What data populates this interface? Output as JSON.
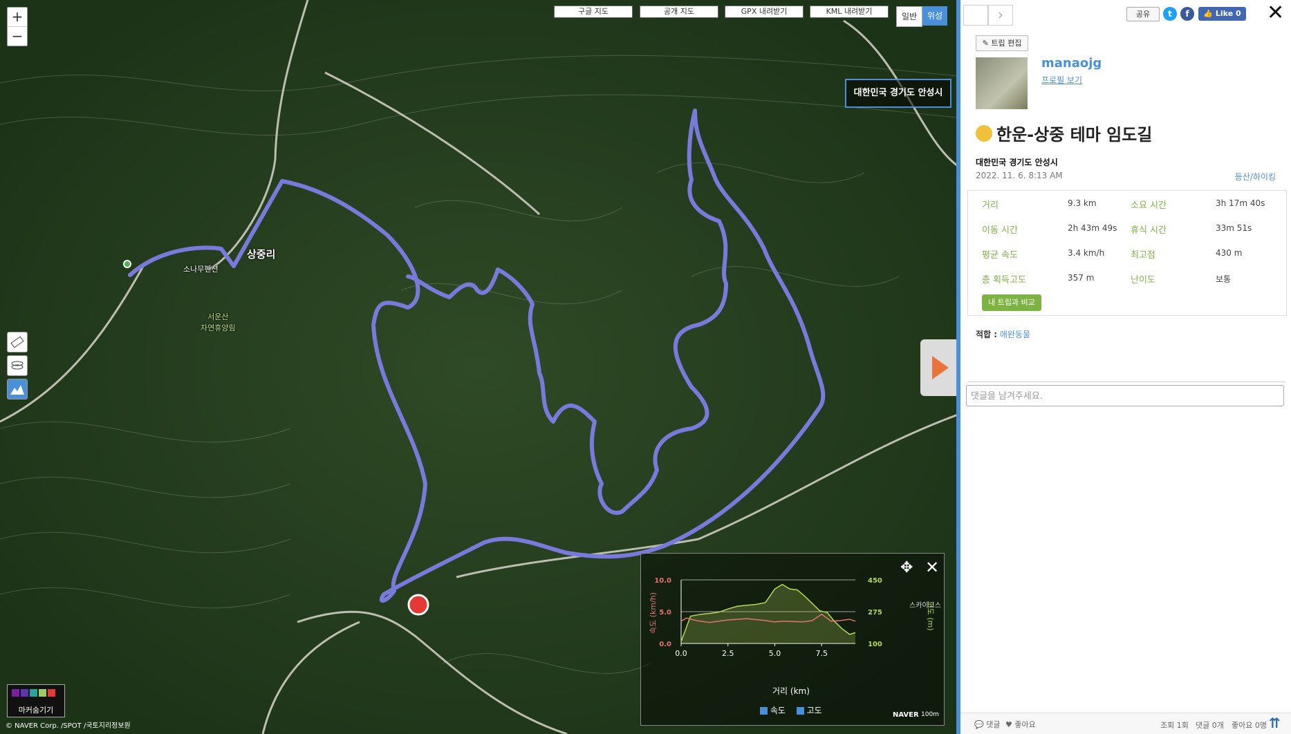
{
  "map": {
    "zoom_in": "+",
    "zoom_out": "−",
    "top_buttons": [
      "구글 지도",
      "공개 지도",
      "GPX 내려받기",
      "KML 내려받기"
    ],
    "map_types": [
      "일반",
      "위성"
    ],
    "location_label": "대한민국 경기도 안성시",
    "labels": [
      "상중리",
      "소나무펜션",
      "서운산\n자연휴양림",
      "스카이코스"
    ],
    "marker_tool": "마커숨기기",
    "copyright": "© NAVER Corp. /SPOT /국토지리정보원",
    "naver": "NAVER",
    "scale": "100m"
  },
  "chart_data": {
    "type": "line",
    "title": "",
    "xlabel": "거리 (km)",
    "ylabel_left": "속도 (km/h)",
    "ylabel_right": "고도 (m)",
    "xlim": [
      0,
      9.3
    ],
    "xticks": [
      "0.0",
      "2.5",
      "5.0",
      "7.5"
    ],
    "ylim_left": [
      0,
      10
    ],
    "yticks_left": [
      "0.0",
      "5.0",
      "10.0"
    ],
    "ylim_right": [
      100,
      450
    ],
    "yticks_right": [
      "100",
      "275",
      "450"
    ],
    "series": [
      {
        "name": "속도",
        "axis": "left",
        "color": "#e57373",
        "x": [
          0,
          0.3,
          0.8,
          1.5,
          2.5,
          3.5,
          4.5,
          5.0,
          5.5,
          6.5,
          7.0,
          7.5,
          8.0,
          8.5,
          9.0,
          9.3
        ],
        "values": [
          3.5,
          4.0,
          3.6,
          3.3,
          3.7,
          3.9,
          3.6,
          3.4,
          3.5,
          3.4,
          3.6,
          4.6,
          3.5,
          3.6,
          3.8,
          3.5
        ]
      },
      {
        "name": "고도",
        "axis": "right",
        "color": "#b8d85a",
        "x": [
          0,
          0.5,
          1.0,
          1.5,
          2.0,
          2.5,
          3.0,
          3.5,
          4.0,
          4.5,
          5.0,
          5.4,
          5.8,
          6.2,
          6.6,
          7.0,
          7.4,
          7.8,
          8.2,
          8.6,
          9.0,
          9.3
        ],
        "values": [
          110,
          250,
          260,
          265,
          272,
          290,
          305,
          310,
          315,
          325,
          400,
          425,
          400,
          395,
          360,
          320,
          280,
          270,
          220,
          180,
          150,
          160
        ]
      }
    ],
    "legend": [
      "속도",
      "고도"
    ]
  },
  "panel": {
    "share": "공유",
    "like": "Like 0",
    "edit": "트립 편집",
    "username": "manaojg",
    "profile_link": "프로필 보기",
    "title": "한운-상중 테마 임도길",
    "region": "대한민국 경기도 안성시",
    "date": "2022. 11. 6. 8:13 AM",
    "category": "등산/하이킹",
    "stats": [
      {
        "label": "거리",
        "value": "9.3 km"
      },
      {
        "label": "소요 시간",
        "value": "3h 17m 40s"
      },
      {
        "label": "이동 시간",
        "value": "2h 43m 49s"
      },
      {
        "label": "휴식 시간",
        "value": "33m 51s"
      },
      {
        "label": "평균 속도",
        "value": "3.4 km/h"
      },
      {
        "label": "최고점",
        "value": "430 m"
      },
      {
        "label": "총 획득고도",
        "value": "357 m"
      },
      {
        "label": "난이도",
        "value": "보통"
      }
    ],
    "compare_btn": "내 트립과 비교",
    "suitable_label": "적합 :",
    "suitable_value": "애완동물",
    "comment_placeholder": "댓글을 남겨주세요.",
    "bottom": {
      "comments": "댓글",
      "likes": "좋아요",
      "views": "조회 1회",
      "comment_count": "댓글 0개",
      "like_count": "좋아요 0명"
    }
  }
}
